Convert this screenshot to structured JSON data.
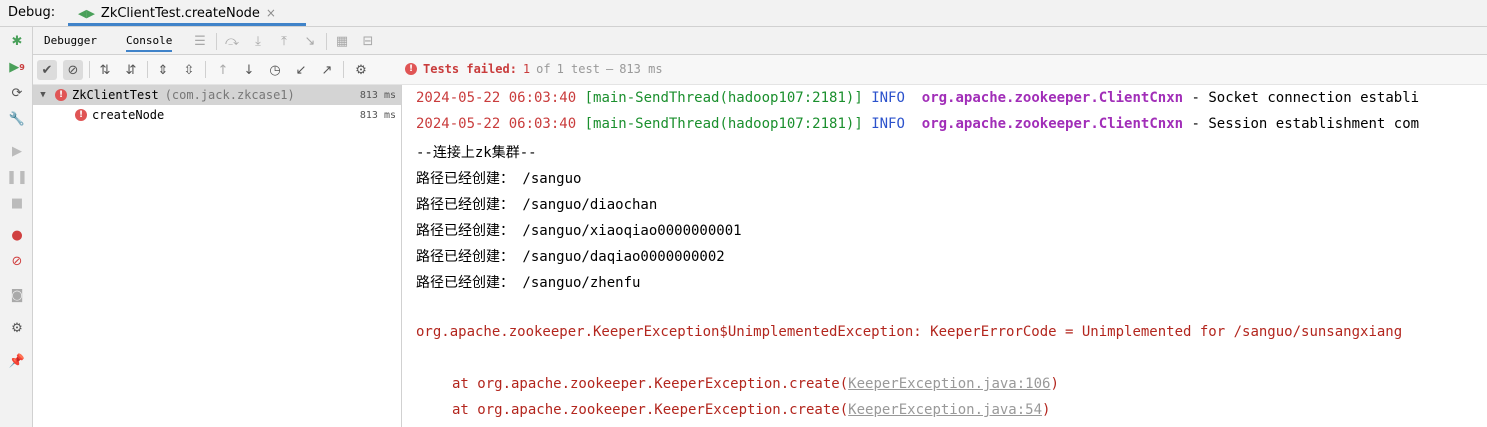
{
  "header": {
    "debug_label": "Debug:",
    "tab_title": "ZkClientTest.createNode",
    "tab_close": "×"
  },
  "subtabs": {
    "debugger": "Debugger",
    "console": "Console"
  },
  "left_badge": "9",
  "status": {
    "failed_label": "Tests failed:",
    "failed_count": "1",
    "of_label": "of",
    "total_label": "1 test",
    "dash": "–",
    "duration": "813 ms"
  },
  "tree": {
    "root": {
      "name": "ZkClientTest",
      "package": "(com.jack.zkcase1)",
      "time": "813 ms"
    },
    "child": {
      "name": "createNode",
      "time": "813 ms"
    }
  },
  "console": {
    "log1": {
      "date": "2024-05-22 06:03:40",
      "thread": "[main-SendThread(hadoop107:2181)]",
      "level": "INFO",
      "logger": "org.apache.zookeeper.ClientCnxn",
      "message": "- Socket connection establi"
    },
    "log2": {
      "date": "2024-05-22 06:03:40",
      "thread": "[main-SendThread(hadoop107:2181)]",
      "level": "INFO",
      "logger": "org.apache.zookeeper.ClientCnxn",
      "message": "- Session establishment com"
    },
    "plain_lines": [
      "--连接上zk集群--",
      "路径已经创建： /sanguo",
      "路径已经创建： /sanguo/diaochan",
      "路径已经创建： /sanguo/xiaoqiao0000000001",
      "路径已经创建： /sanguo/daqiao0000000002",
      "路径已经创建： /sanguo/zhenfu"
    ],
    "exception": "org.apache.zookeeper.KeeperException$UnimplementedException: KeeperErrorCode = Unimplemented for /sanguo/sunsangxiang",
    "stack": [
      {
        "at": "at org.apache.zookeeper.KeeperException.create(",
        "link": "KeeperException.java:106",
        "close": ")"
      },
      {
        "at": "at org.apache.zookeeper.KeeperException.create(",
        "link": "KeeperException.java:54",
        "close": ")"
      }
    ]
  },
  "colors": {
    "accent": "#4083c9",
    "error": "#c93c3c",
    "thread_green": "#1a8f2d",
    "info_blue": "#2b52cc",
    "logger_purple": "#a12eb8"
  }
}
